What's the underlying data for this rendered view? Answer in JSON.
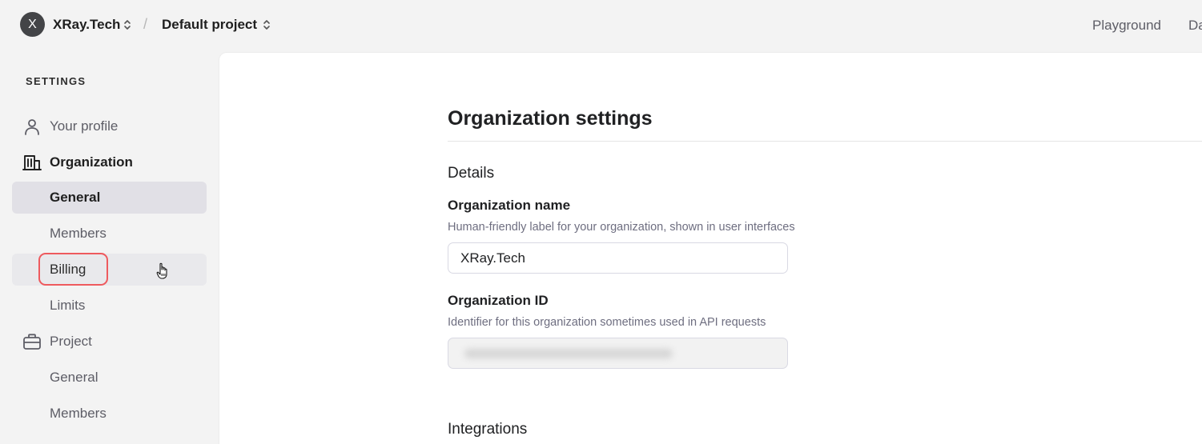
{
  "header": {
    "org_avatar_letter": "X",
    "org_name": "XRay.Tech",
    "separator": "/",
    "project_name": "Default project",
    "nav": [
      "Playground",
      "Da"
    ]
  },
  "sidebar": {
    "heading": "SETTINGS",
    "items": [
      {
        "label": "Your profile",
        "icon": "person-icon"
      },
      {
        "label": "Organization",
        "icon": "building-icon"
      },
      {
        "label": "General"
      },
      {
        "label": "Members"
      },
      {
        "label": "Billing"
      },
      {
        "label": "Limits"
      },
      {
        "label": "Project",
        "icon": "briefcase-icon"
      },
      {
        "label": "General"
      },
      {
        "label": "Members"
      }
    ]
  },
  "main": {
    "title": "Organization settings",
    "details_heading": "Details",
    "org_name_label": "Organization name",
    "org_name_help": "Human-friendly label for your organization, shown in user interfaces",
    "org_name_value": "XRay.Tech",
    "org_id_label": "Organization ID",
    "org_id_help": "Identifier for this organization sometimes used in API requests",
    "integrations_heading": "Integrations"
  },
  "colors": {
    "page_bg": "#f3f3f3",
    "active_item_bg": "#e1e0e6",
    "highlight_ring": "#ee5a5e",
    "avatar_bg": "#434447"
  }
}
